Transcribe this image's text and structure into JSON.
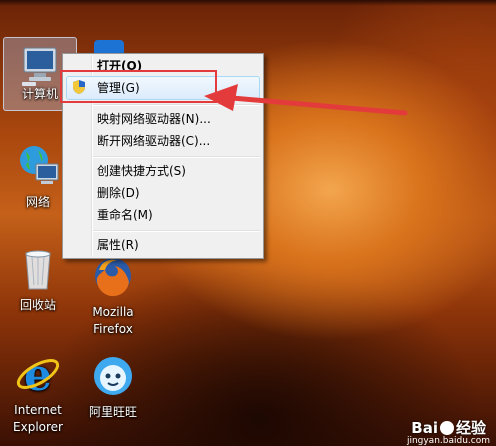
{
  "desktop": {
    "icons": [
      {
        "label": "计算机"
      },
      {
        "label": "网络"
      },
      {
        "label": "回收站"
      },
      {
        "label": "Mozilla Firefox",
        "line1": "Mozilla",
        "line2": "Firefox"
      },
      {
        "label": "Internet Explorer",
        "line1": "Internet",
        "line2": "Explorer"
      },
      {
        "label": "阿里旺旺"
      }
    ]
  },
  "context_menu": {
    "items": [
      {
        "label": "打开(O)",
        "bold": true
      },
      {
        "label": "管理(G)",
        "highlighted": true,
        "icon": "uac-shield-icon"
      },
      {
        "label": "映射网络驱动器(N)..."
      },
      {
        "label": "断开网络驱动器(C)..."
      },
      {
        "label": "创建快捷方式(S)"
      },
      {
        "label": "删除(D)"
      },
      {
        "label": "重命名(M)"
      },
      {
        "label": "属性(R)"
      }
    ]
  },
  "watermark": {
    "brand": "Bai",
    "brand2": "经验",
    "url": "jingyan.baidu.com"
  },
  "colors": {
    "annotation_red": "#e33b3b",
    "menu_bg": "#f0f0f0",
    "highlight_border": "#a8d8f6"
  }
}
